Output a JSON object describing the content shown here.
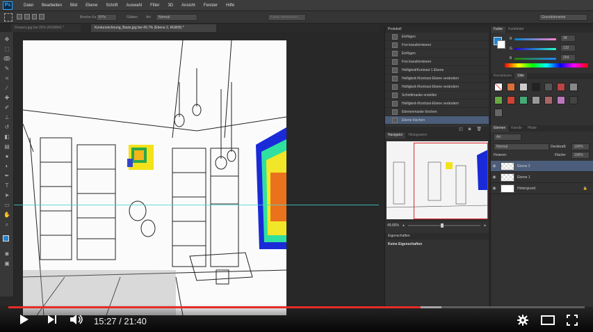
{
  "app": {
    "logo": "Ps"
  },
  "menubar": {
    "items": [
      "Datei",
      "Bearbeiten",
      "Bild",
      "Ebene",
      "Schrift",
      "Auswahl",
      "Filter",
      "3D",
      "Ansicht",
      "Fenster",
      "Hilfe"
    ]
  },
  "options": {
    "brush_width_label": "Breche Kante",
    "brush_width_value": "8 Px",
    "glaetten_label": "Glätten",
    "art_label": "Art:",
    "art_value": "Normal",
    "refine_button": "Kante verbessern...",
    "workspace": "Grundelemente"
  },
  "tabs": [
    {
      "label": "Flowers.jpg bei 25% (RGB/8#) *"
    },
    {
      "label": "Konturzeichnung_Basis.jpg bei 49,7% (Ebene 2, RGB/8) *"
    }
  ],
  "history": {
    "title": "Protokoll",
    "items": [
      "Einfügen",
      "Frei transformieren",
      "Einfügen",
      "Frei transformieren",
      "Helligkeit/Kontrast 1 Ebene",
      "Helligkeit-/Kontrast-Ebene verändern",
      "Helligkeit-/Kontrast-Ebene verändern",
      "Schnittmaske erstellen",
      "Helligkeit-/Kontrast-Ebene verändern",
      "Ebenenmaske löschen",
      "Ebene löschen"
    ],
    "selected_index": 10
  },
  "navigator": {
    "tab_active": "Navigator",
    "tab_other": "Histogramm",
    "zoom": "49,66%"
  },
  "properties": {
    "title": "Eigenschaften",
    "message": "Keine Eigenschaften"
  },
  "color": {
    "tab_active": "Farbe",
    "tab_other": "Farbfelder",
    "r_label": "R",
    "g_label": "G",
    "b_label": "B",
    "r_value": "38",
    "g_value": "132",
    "b_value": "204",
    "foreground": "#2684cc"
  },
  "adjustments": {
    "tab_active": "Korrekturen",
    "tab_other": "Stile"
  },
  "layers": {
    "tabs": [
      "Ebenen",
      "Kanäle",
      "Pfade"
    ],
    "filter_label": "Art",
    "blend_mode": "Normal",
    "opacity_label": "Deckkraft:",
    "opacity_value": "100%",
    "lock_label": "Fixieren:",
    "fill_label": "Fläche:",
    "fill_value": "100%",
    "items": [
      {
        "name": "Ebene 2",
        "selected": true
      },
      {
        "name": "Ebene 1",
        "selected": false
      },
      {
        "name": "Hintergrund",
        "selected": false
      }
    ]
  },
  "player": {
    "time": "15:27 / 21:40",
    "progress": 0.715,
    "buffered": 0.752
  }
}
